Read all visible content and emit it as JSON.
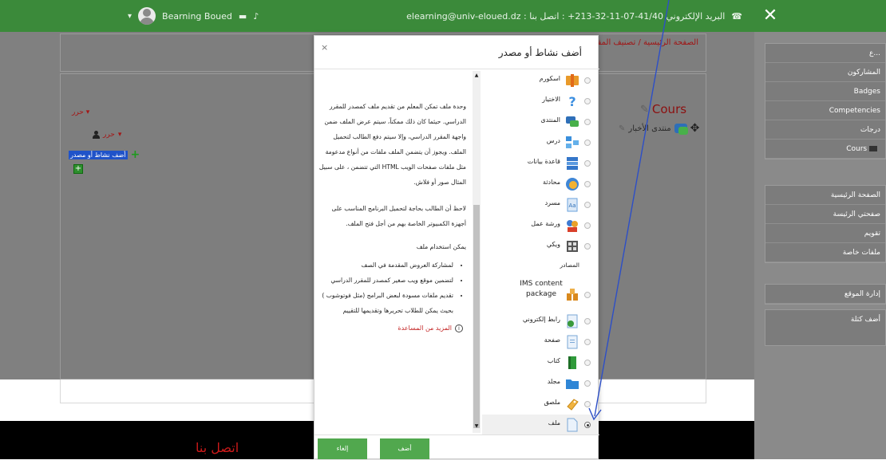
{
  "topbar": {
    "user_name": "Bearning Boued",
    "contact_text": "elearning@univ-eloued.dz : البريد الإلكتروني 41/40-07-11-32-213+ : اتصل بنا",
    "colors": {
      "bar": "#3b8a3a"
    }
  },
  "breadcrumb": "الصفحة الرئيسية / تصنيف المقررات الدراسية",
  "course": {
    "title": "Cours",
    "forum_label": "منتدى الأخبار",
    "edit_label": "حرر",
    "edit_user_label": "حرر",
    "add_activity_label": "أضف نشاط أو مصدر"
  },
  "sidebar": {
    "block1": [
      "ع...",
      "المشاركون",
      "Badges",
      "Competencies",
      "درجات",
      "Cours"
    ],
    "block2": [
      "الصفحة الرئيسية",
      "صفحتي الرئيسة",
      "تقويم",
      "ملفات خاصة"
    ],
    "block3": [
      "إدارة الموقع"
    ],
    "block4": [
      "أضف كتلة"
    ]
  },
  "modal": {
    "title": "أضف نشاط أو مصدر",
    "close": "×",
    "description": [
      "وحدة ملف تمكن المعلم من تقديم ملف كمصدر للمقرر الدراسي. حيثما كان ذلك ممكناً، سيتم عرض الملف ضمن واجهة المقرر الدراسي، وإلا سيتم دفع الطالب لتحميل الملف. ويجوز أن يتضمن الملف ملفات من أنواع مدعومة مثل ملفات صفحات الويب HTML التي تتضمن ، على سبيل المثال صور أو فلاش.",
      "لاحظ أن الطالب بحاجة لتحميل البرنامج المناسب على أجهزة الكمبيوتر الخاصة بهم من أجل فتح الملف.",
      "يمكن استخدام ملف"
    ],
    "uses": [
      "لمشاركة العروض المقدمة في الصف",
      "لتضمين موقع ويب صغير كمصدر للمقرر الدراسي",
      "تقديم ملفات مسودة لبعض البرامج (مثل فوتوشوب ) بحيث يمكن للطلاب تحريرها وتقديمها للتقييم"
    ],
    "help_link": "المزيد من المساعدة",
    "activities": [
      {
        "label": "اسكورم",
        "icon": "scorm-icon"
      },
      {
        "label": "الاختيار",
        "icon": "choice-icon"
      },
      {
        "label": "المنتدى",
        "icon": "forum-icon"
      },
      {
        "label": "درس",
        "icon": "lesson-icon"
      },
      {
        "label": "قاعدة بيانات",
        "icon": "database-icon"
      },
      {
        "label": "محادثة",
        "icon": "chat-icon"
      },
      {
        "label": "مسرد",
        "icon": "glossary-icon"
      },
      {
        "label": "ورشة عمل",
        "icon": "workshop-icon"
      },
      {
        "label": "ويكي",
        "icon": "wiki-icon"
      }
    ],
    "resources_heading": "المصادر",
    "resources": [
      {
        "label": "IMS content package",
        "icon": "ims-package-icon"
      },
      {
        "label": "رابط إلكتروني",
        "icon": "url-icon"
      },
      {
        "label": "صفحة",
        "icon": "page-icon"
      },
      {
        "label": "كتاب",
        "icon": "book-icon"
      },
      {
        "label": "مجلد",
        "icon": "folder-icon"
      },
      {
        "label": "ملصق",
        "icon": "label-icon"
      },
      {
        "label": "ملف",
        "icon": "file-icon",
        "selected": true
      }
    ],
    "add_button": "أضف",
    "cancel_button": "إلغاء"
  },
  "footer": {
    "contact": "اتصل بنا"
  }
}
